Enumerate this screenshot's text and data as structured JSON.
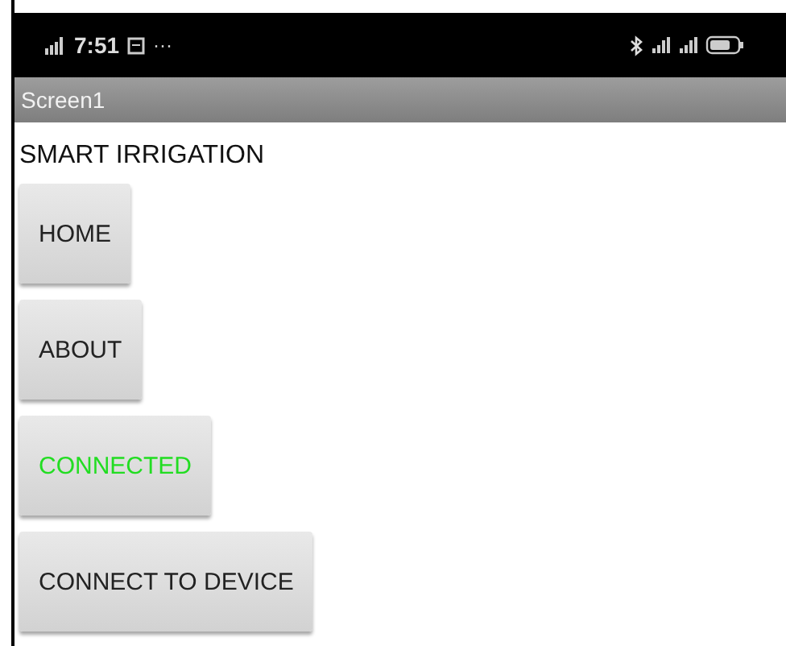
{
  "status_bar": {
    "time": "7:51",
    "dots": "···"
  },
  "title_bar": {
    "title": "Screen1"
  },
  "heading": "SMART IRRIGATION",
  "buttons": [
    {
      "label": "HOME",
      "color": "#222222"
    },
    {
      "label": "ABOUT",
      "color": "#222222"
    },
    {
      "label": "CONNECTED",
      "color": "#22dd22"
    },
    {
      "label": "CONNECT TO DEVICE",
      "color": "#222222"
    }
  ]
}
